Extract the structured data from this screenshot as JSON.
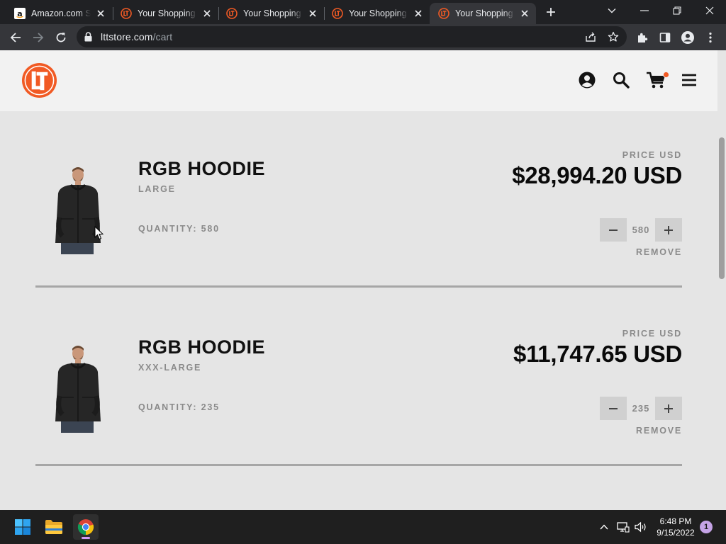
{
  "browser": {
    "tabs": [
      {
        "title": "Amazon.com Shopping Cart",
        "favicon": "amazon-icon"
      },
      {
        "title": "Your Shopping Cart",
        "favicon": "ltt-icon"
      },
      {
        "title": "Your Shopping Cart",
        "favicon": "ltt-icon"
      },
      {
        "title": "Your Shopping Cart",
        "favicon": "ltt-icon"
      },
      {
        "title": "Your Shopping Cart",
        "favicon": "ltt-icon",
        "active": true
      }
    ],
    "url": {
      "host": "lttstore.com",
      "path": "/cart"
    }
  },
  "cart": {
    "items": [
      {
        "name": "RGB HOODIE",
        "size": "LARGE",
        "quantity_text": "QUANTITY: 580",
        "quantity": "580",
        "price_label": "PRICE USD",
        "price": "$28,994.20 USD",
        "remove": "REMOVE"
      },
      {
        "name": "RGB HOODIE",
        "size": "XXX-LARGE",
        "quantity_text": "QUANTITY: 235",
        "quantity": "235",
        "price_label": "PRICE USD",
        "price": "$11,747.65 USD",
        "remove": "REMOVE"
      }
    ]
  },
  "taskbar": {
    "time": "6:48 PM",
    "date": "9/15/2022",
    "notifications": "1"
  },
  "colors": {
    "brand_orange": "#f15a24",
    "page_bg": "#e5e5e5",
    "header_bg": "#f2f2f2"
  }
}
